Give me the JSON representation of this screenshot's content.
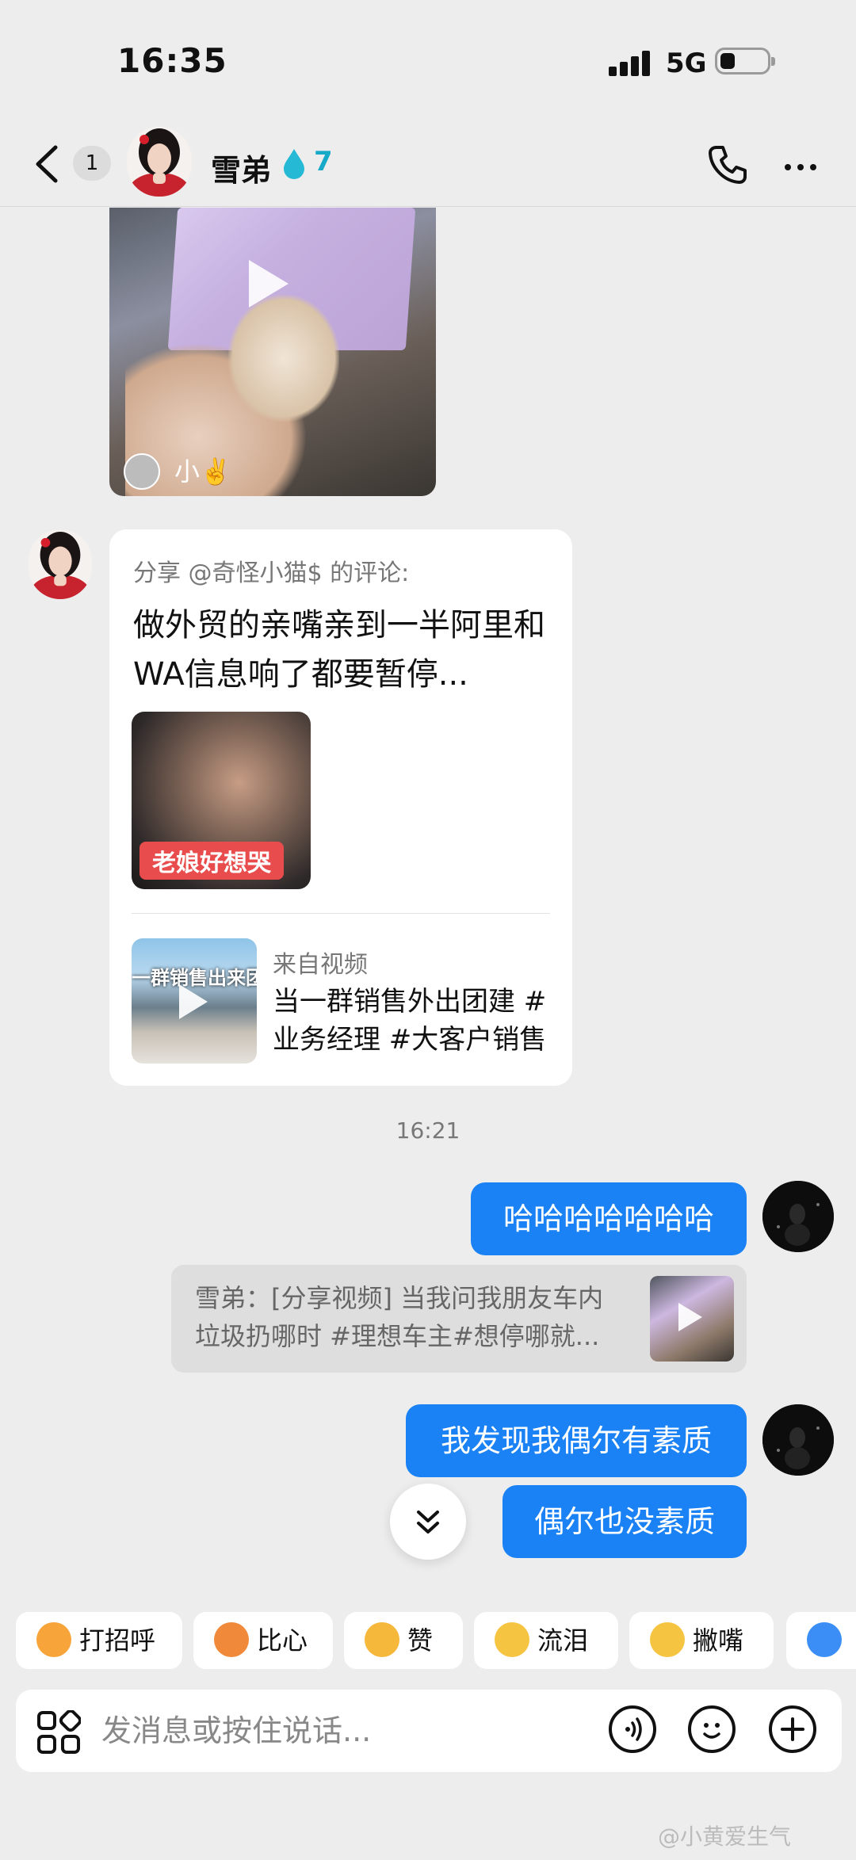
{
  "status_bar": {
    "time": "16:35",
    "network": "5G"
  },
  "header": {
    "unread_count": "1",
    "contact_name": "雪弟",
    "fire_count": "7"
  },
  "video_card": {
    "user_label": "小✌️"
  },
  "share_card": {
    "from": "分享 @奇怪小猫$ 的评论:",
    "text": "做外贸的亲嘴亲到一半阿里和WA信息响了都要暂停...",
    "thumb_tag": "老娘好想哭",
    "from_label": "来自视频",
    "from_title": "当一群销售外出团建 #业务经理 #大客户销售",
    "from_thumb_text": "一群销售出来团建"
  },
  "timestamp": "16:21",
  "messages": {
    "m1": "哈哈哈哈哈哈哈",
    "quote": "雪弟：[分享视频] 当我问我朋友车内垃圾扔哪时 #理想车主#想停哪就...",
    "m2": "我发现我偶尔有素质",
    "m3": "偶尔也没素质"
  },
  "quick_replies": [
    {
      "label": "打招呼",
      "icon": "smile-wave-icon",
      "color": "#f7a53a"
    },
    {
      "label": "比心",
      "icon": "heart-hand-icon",
      "color": "#f08a3a"
    },
    {
      "label": "赞",
      "icon": "thumbs-up-icon",
      "color": "#f5b83a"
    },
    {
      "label": "流泪",
      "icon": "crying-face-icon",
      "color": "#f5c542"
    },
    {
      "label": "撇嘴",
      "icon": "pouting-face-icon",
      "color": "#f5c542"
    },
    {
      "label": "",
      "icon": "more-emoji-icon",
      "color": "#3a8ef5"
    }
  ],
  "input": {
    "placeholder": "发消息或按住说话..."
  },
  "watermark": "@小黄爱生气"
}
